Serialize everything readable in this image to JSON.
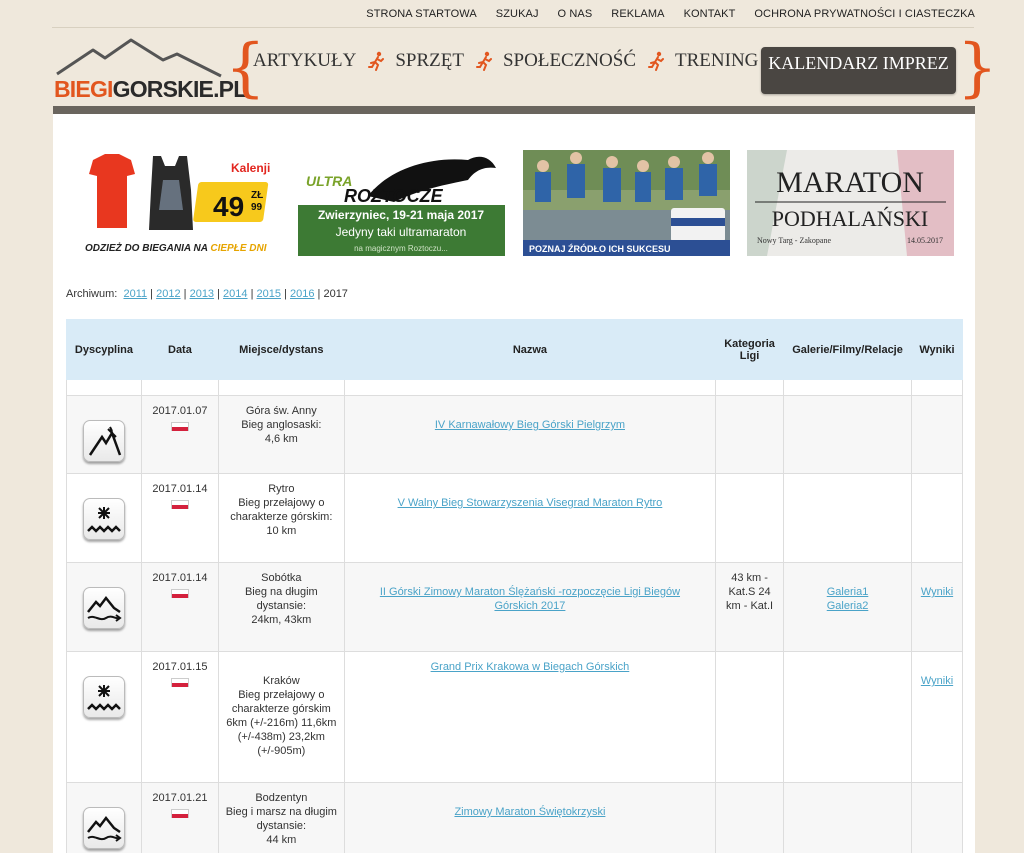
{
  "topnav": [
    "STRONA STARTOWA",
    "SZUKAJ",
    "O NAS",
    "REKLAMA",
    "KONTAKT",
    "OCHRONA PRYWATNOŚCI I CIASTECZKA"
  ],
  "logo": {
    "part1": "BIEGI",
    "part2": "GORSKIE.PL"
  },
  "mainnav": [
    "ARTYKUŁY",
    "SPRZĘT",
    "SPOŁECZNOŚĆ",
    "TRENING"
  ],
  "calendar_button": "KALENDARZ IMPREZ",
  "banners": {
    "kalenji": {
      "brand": "Kalenji",
      "price": "49",
      "price_cents": "99",
      "currency": "ZŁ",
      "caption1": "ODZIEŻ DO BIEGANIA NA ",
      "caption2": "CIEPŁE DNI"
    },
    "roztocze": {
      "title1": "ULTRA",
      "title2": "ROZTOCZE",
      "line1": "Zwierzyniec, 19-21 maja 2017",
      "line2": "Jedyny taki ultramaraton",
      "line3": "na magicznym Roztoczu..."
    },
    "source": {
      "caption": "POZNAJ ŹRÓDŁO ICH SUKCESU"
    },
    "podhale": {
      "line1": "MARATON",
      "line2": "PODHALAŃSKI",
      "place": "Nowy Targ - Zakopane",
      "date": "14.05.2017"
    }
  },
  "archive": {
    "label": "Archiwum:",
    "years": [
      "2011",
      "2012",
      "2013",
      "2014",
      "2015",
      "2016"
    ],
    "current": "2017"
  },
  "table": {
    "headers": [
      "Dyscyplina",
      "Data",
      "Miejsce/dystans",
      "Nazwa",
      "Kategoria Ligi",
      "Galerie/Filmy/Relacje",
      "Wyniki"
    ],
    "rows": [
      {
        "discipline_icon": "anglosaski-icon",
        "date": "2017.01.07",
        "place": "Góra św. Anny",
        "desc": "Bieg anglosaski:",
        "dist": "4,6 km",
        "name": "IV Karnawałowy Bieg Górski Pielgrzym",
        "category": "",
        "gallery": [],
        "results": ""
      },
      {
        "discipline_icon": "przelajowy-icon",
        "date": "2017.01.14",
        "place": "Rytro",
        "desc": "Bieg przełajowy o charakterze górskim:",
        "dist": "10 km",
        "name": "V Walny Bieg Stowarzyszenia Visegrad Maraton Rytro",
        "category": "",
        "gallery": [],
        "results": ""
      },
      {
        "discipline_icon": "dlugi-dystans-icon",
        "date": "2017.01.14",
        "place": "Sobótka",
        "desc": "Bieg na długim dystansie:",
        "dist": "24km, 43km",
        "name": "II Górski Zimowy Maraton Ślężański -rozpoczęcie Ligi Biegów Górskich 2017",
        "category": "43 km - Kat.S 24 km - Kat.I",
        "gallery": [
          "Galeria1",
          "Galeria2"
        ],
        "results": "Wyniki"
      },
      {
        "discipline_icon": "przelajowy-icon",
        "date": "2017.01.15",
        "place": "Kraków",
        "desc": "Bieg przełajowy o charakterze górskim",
        "dist": "6km (+/-216m) 11,6km (+/-438m) 23,2km (+/-905m)",
        "name": "Grand Prix Krakowa w Biegach Górskich",
        "category": "",
        "gallery": [],
        "results": "Wyniki"
      },
      {
        "discipline_icon": "dlugi-dystans-icon",
        "date": "2017.01.21",
        "place": "Bodzentyn",
        "desc": "Bieg i marsz na długim dystansie:",
        "dist": "44 km",
        "name": "Zimowy Maraton Świętokrzyski",
        "category": "",
        "gallery": [],
        "results": ""
      }
    ]
  },
  "colors": {
    "accent": "#e2561f",
    "link": "#4aa3c8",
    "header_bg": "#d9ebf7",
    "nav_dark": "#4a4642"
  }
}
